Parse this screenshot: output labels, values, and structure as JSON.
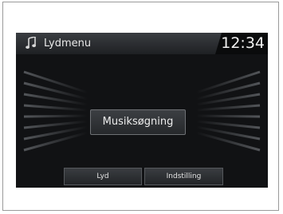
{
  "header": {
    "icon": "music-note-icon",
    "title": "Lydmenu",
    "clock": "12:34"
  },
  "main": {
    "center_button_label": "Musiksøgning"
  },
  "bottom_tabs": [
    {
      "label": "Lyd"
    },
    {
      "label": "Indstilling"
    }
  ],
  "colors": {
    "screen_background": "#111214",
    "text": "#e8e8e8",
    "frame_border": "#9a9a9a"
  }
}
